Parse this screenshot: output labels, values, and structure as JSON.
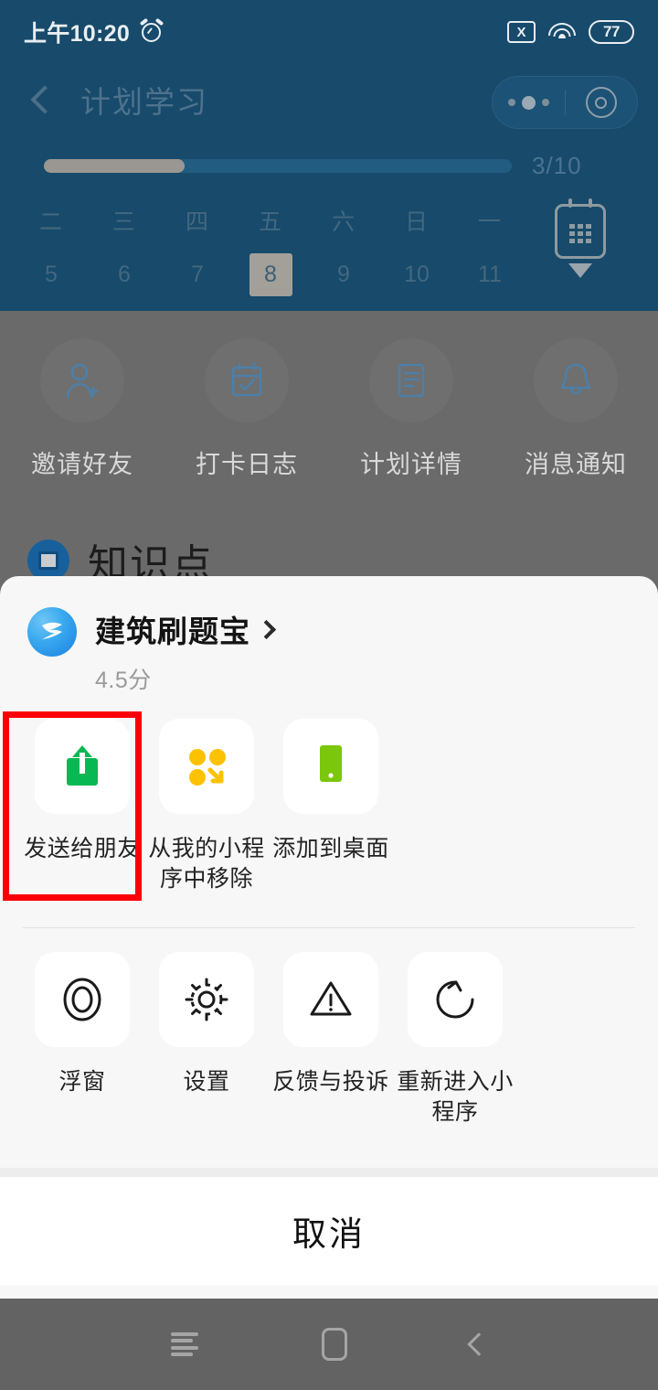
{
  "status_bar": {
    "time": "上午10:20",
    "alarm_icon": "alarm-clock-icon",
    "no_sim_icon": "no-sim-icon",
    "no_sim_glyph": "X",
    "wifi_icon": "wifi-icon",
    "battery_icon": "battery-icon",
    "battery_level": "77"
  },
  "nav": {
    "back_icon": "back-chevron-icon",
    "title": "计划学习",
    "capsule": {
      "more_icon": "more-dots-icon",
      "close_icon": "close-target-icon"
    }
  },
  "progress": {
    "label": "3/10",
    "current": 3,
    "total": 10,
    "percent": 30
  },
  "calendar": {
    "days": [
      {
        "dow": "二",
        "num": "5",
        "selected": false
      },
      {
        "dow": "三",
        "num": "6",
        "selected": false
      },
      {
        "dow": "四",
        "num": "7",
        "selected": false
      },
      {
        "dow": "五",
        "num": "8",
        "selected": true
      },
      {
        "dow": "六",
        "num": "9",
        "selected": false
      },
      {
        "dow": "日",
        "num": "10",
        "selected": false
      },
      {
        "dow": "一",
        "num": "11",
        "selected": false
      }
    ],
    "expand_icon": "calendar-expand-icon"
  },
  "quick_actions": [
    {
      "label": "邀请好友",
      "icon": "invite-friend-icon"
    },
    {
      "label": "打卡日志",
      "icon": "checkin-log-icon"
    },
    {
      "label": "计划详情",
      "icon": "plan-detail-icon"
    },
    {
      "label": "消息通知",
      "icon": "notification-bell-icon"
    }
  ],
  "knowledge_section": {
    "title": "知识点",
    "icon": "knowledge-point-icon"
  },
  "sheet": {
    "app": {
      "logo_icon": "app-logo-z-icon",
      "name": "建筑刷题宝",
      "chevron_icon": "chevron-right-icon",
      "score": "4.5分"
    },
    "tiles_row1": [
      {
        "label": "发送给朋友",
        "icon": "share-to-friend-icon",
        "highlighted": true
      },
      {
        "label": "从我的小程序中移除",
        "icon": "remove-from-miniprogram-icon",
        "highlighted": false
      },
      {
        "label": "添加到桌面",
        "icon": "add-to-homescreen-icon",
        "highlighted": false
      }
    ],
    "tiles_row2": [
      {
        "label": "浮窗",
        "icon": "float-window-icon"
      },
      {
        "label": "设置",
        "icon": "settings-gear-icon"
      },
      {
        "label": "反馈与投诉",
        "icon": "feedback-warning-icon"
      },
      {
        "label": "重新进入小程序",
        "icon": "reload-miniprogram-icon"
      }
    ],
    "cancel_label": "取消"
  },
  "android_nav": {
    "menu_icon": "android-menu-icon",
    "home_icon": "android-home-icon",
    "back_icon": "android-back-icon"
  },
  "colors": {
    "header_blue": "#174a6b",
    "dim_gray": "#6a6a6a",
    "sheet_bg": "#f7f7f7",
    "annotation_red": "#fb0007",
    "share_green": "#08b853",
    "remove_orange": "#fcc200",
    "desktop_green": "#7ac70c"
  }
}
